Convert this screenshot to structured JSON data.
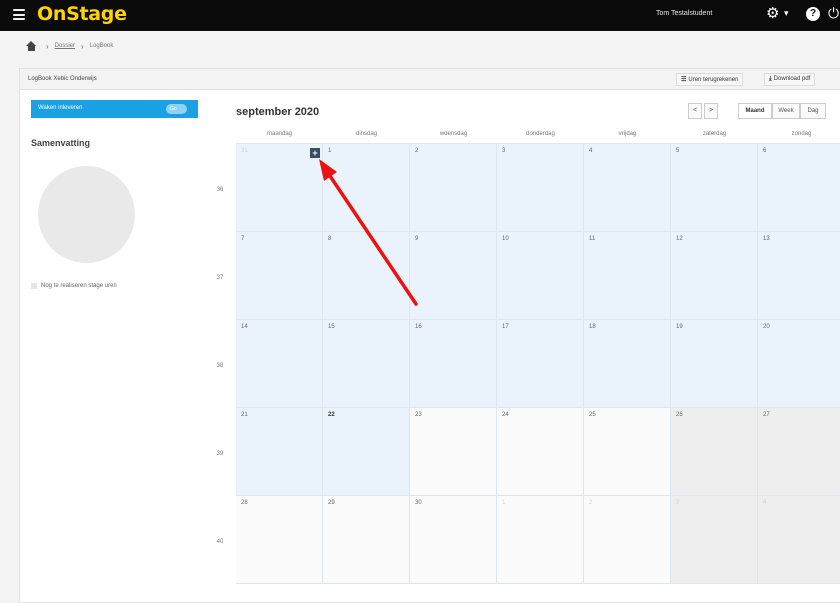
{
  "app": {
    "brand": "OnStage",
    "user_name": "Tom Testalstudent"
  },
  "icons": [
    "menu-icon",
    "gear-icon",
    "caret-down-icon",
    "help-icon",
    "power-icon",
    "home-icon",
    "chevron-right-icon",
    "list-icon",
    "download-icon",
    "plus-icon"
  ],
  "breadcrumb": {
    "home_icon": "home-icon",
    "items": [
      "Dossier",
      "LogBook"
    ]
  },
  "panel": {
    "title": "LogBook Xebic Onderwijs",
    "uren_label": "Uren terugrekenen",
    "download_label": "Download pdf"
  },
  "sidebar": {
    "waken_label": "Waken inleveren",
    "toggle_label": "Go",
    "summary_title": "Samenvatting",
    "legend_label": "Nog te realiseren stage uren"
  },
  "calendar": {
    "month_label": "september 2020",
    "prev": "<",
    "next": ">",
    "views": [
      "Maand",
      "Week",
      "Dag"
    ],
    "active_view": "Maand",
    "weekdays": [
      "maandag",
      "dinsdag",
      "woensdag",
      "donderdag",
      "vrijdag",
      "zaterdag",
      "zondag"
    ],
    "weeks": [
      {
        "number": "36",
        "days": [
          "31",
          "1",
          "2",
          "3",
          "4",
          "5",
          "6"
        ]
      },
      {
        "number": "37",
        "days": [
          "7",
          "8",
          "9",
          "10",
          "11",
          "12",
          "13"
        ]
      },
      {
        "number": "38",
        "days": [
          "14",
          "15",
          "16",
          "17",
          "18",
          "19",
          "20"
        ]
      },
      {
        "number": "39",
        "days": [
          "21",
          "22",
          "23",
          "24",
          "25",
          "26",
          "27"
        ]
      },
      {
        "number": "40",
        "days": [
          "28",
          "29",
          "30",
          "1",
          "2",
          "3",
          "4"
        ]
      }
    ],
    "today": "22",
    "add_button": "+"
  },
  "colors": {
    "topbar": "#0b0b0b",
    "brand": "#ffd400",
    "accent": "#1aa1e4",
    "past_day": "#eaf3fb",
    "annotation_arrow": "#ee1111"
  }
}
